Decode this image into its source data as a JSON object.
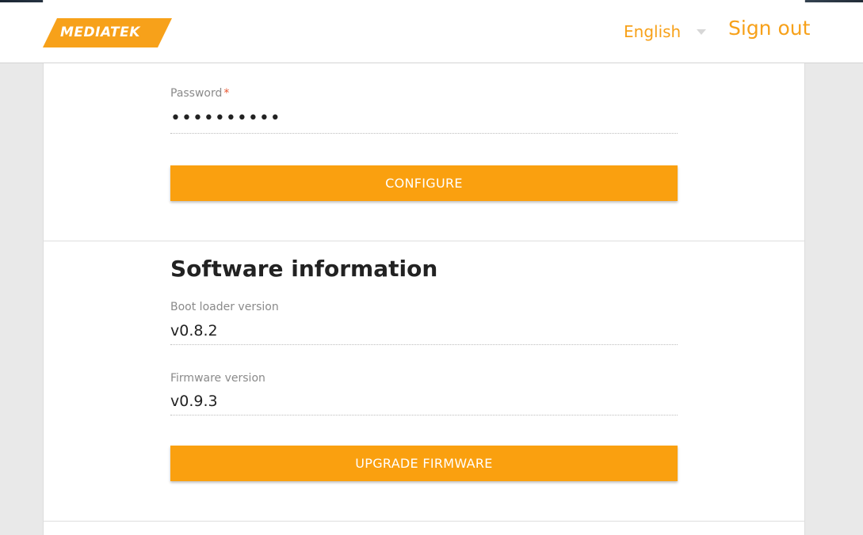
{
  "header": {
    "logo_text": "MEDIATEK",
    "language": "English",
    "sign_out": "Sign out"
  },
  "credentials": {
    "password_label": "Password",
    "required_mark": "*",
    "password_value": "••••••••••",
    "configure_button": "CONFIGURE"
  },
  "software": {
    "title": "Software information",
    "bootloader_label": "Boot loader version",
    "bootloader_value": "v0.8.2",
    "firmware_label": "Firmware version",
    "firmware_value": "v0.9.3",
    "upgrade_button": "UPGRADE FIRMWARE"
  },
  "colors": {
    "accent": "#faa00f",
    "required": "#e8552f"
  }
}
